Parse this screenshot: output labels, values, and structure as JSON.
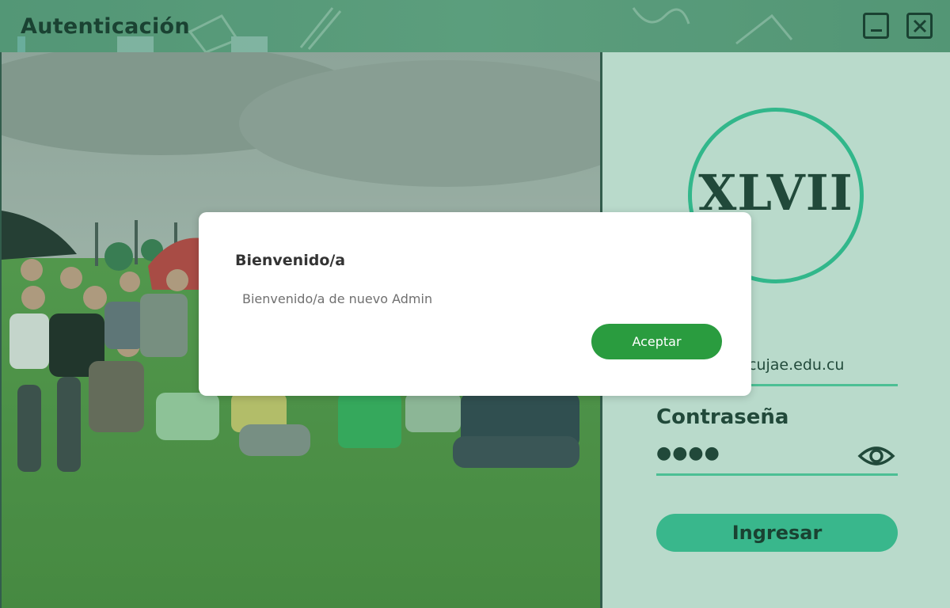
{
  "window": {
    "title": "Autenticación",
    "minimize_icon": "minimize-icon",
    "close_icon": "close-icon"
  },
  "login": {
    "logo_text": "XLVII",
    "email_visible_text": "cujae.edu.cu",
    "password_label": "Contraseña",
    "password_value": "●●●●",
    "show_password_icon": "eye-icon",
    "submit_label": "Ingresar"
  },
  "dialog": {
    "title": "Bienvenido/a",
    "message": "Bienvenido/a de nuevo Admin",
    "accept_label": "Aceptar"
  },
  "colors": {
    "accent": "#3ec99b",
    "dialog_button": "#2a9c3f",
    "panel_bg": "#e2f7ec",
    "titlebar": "#6aa988"
  }
}
